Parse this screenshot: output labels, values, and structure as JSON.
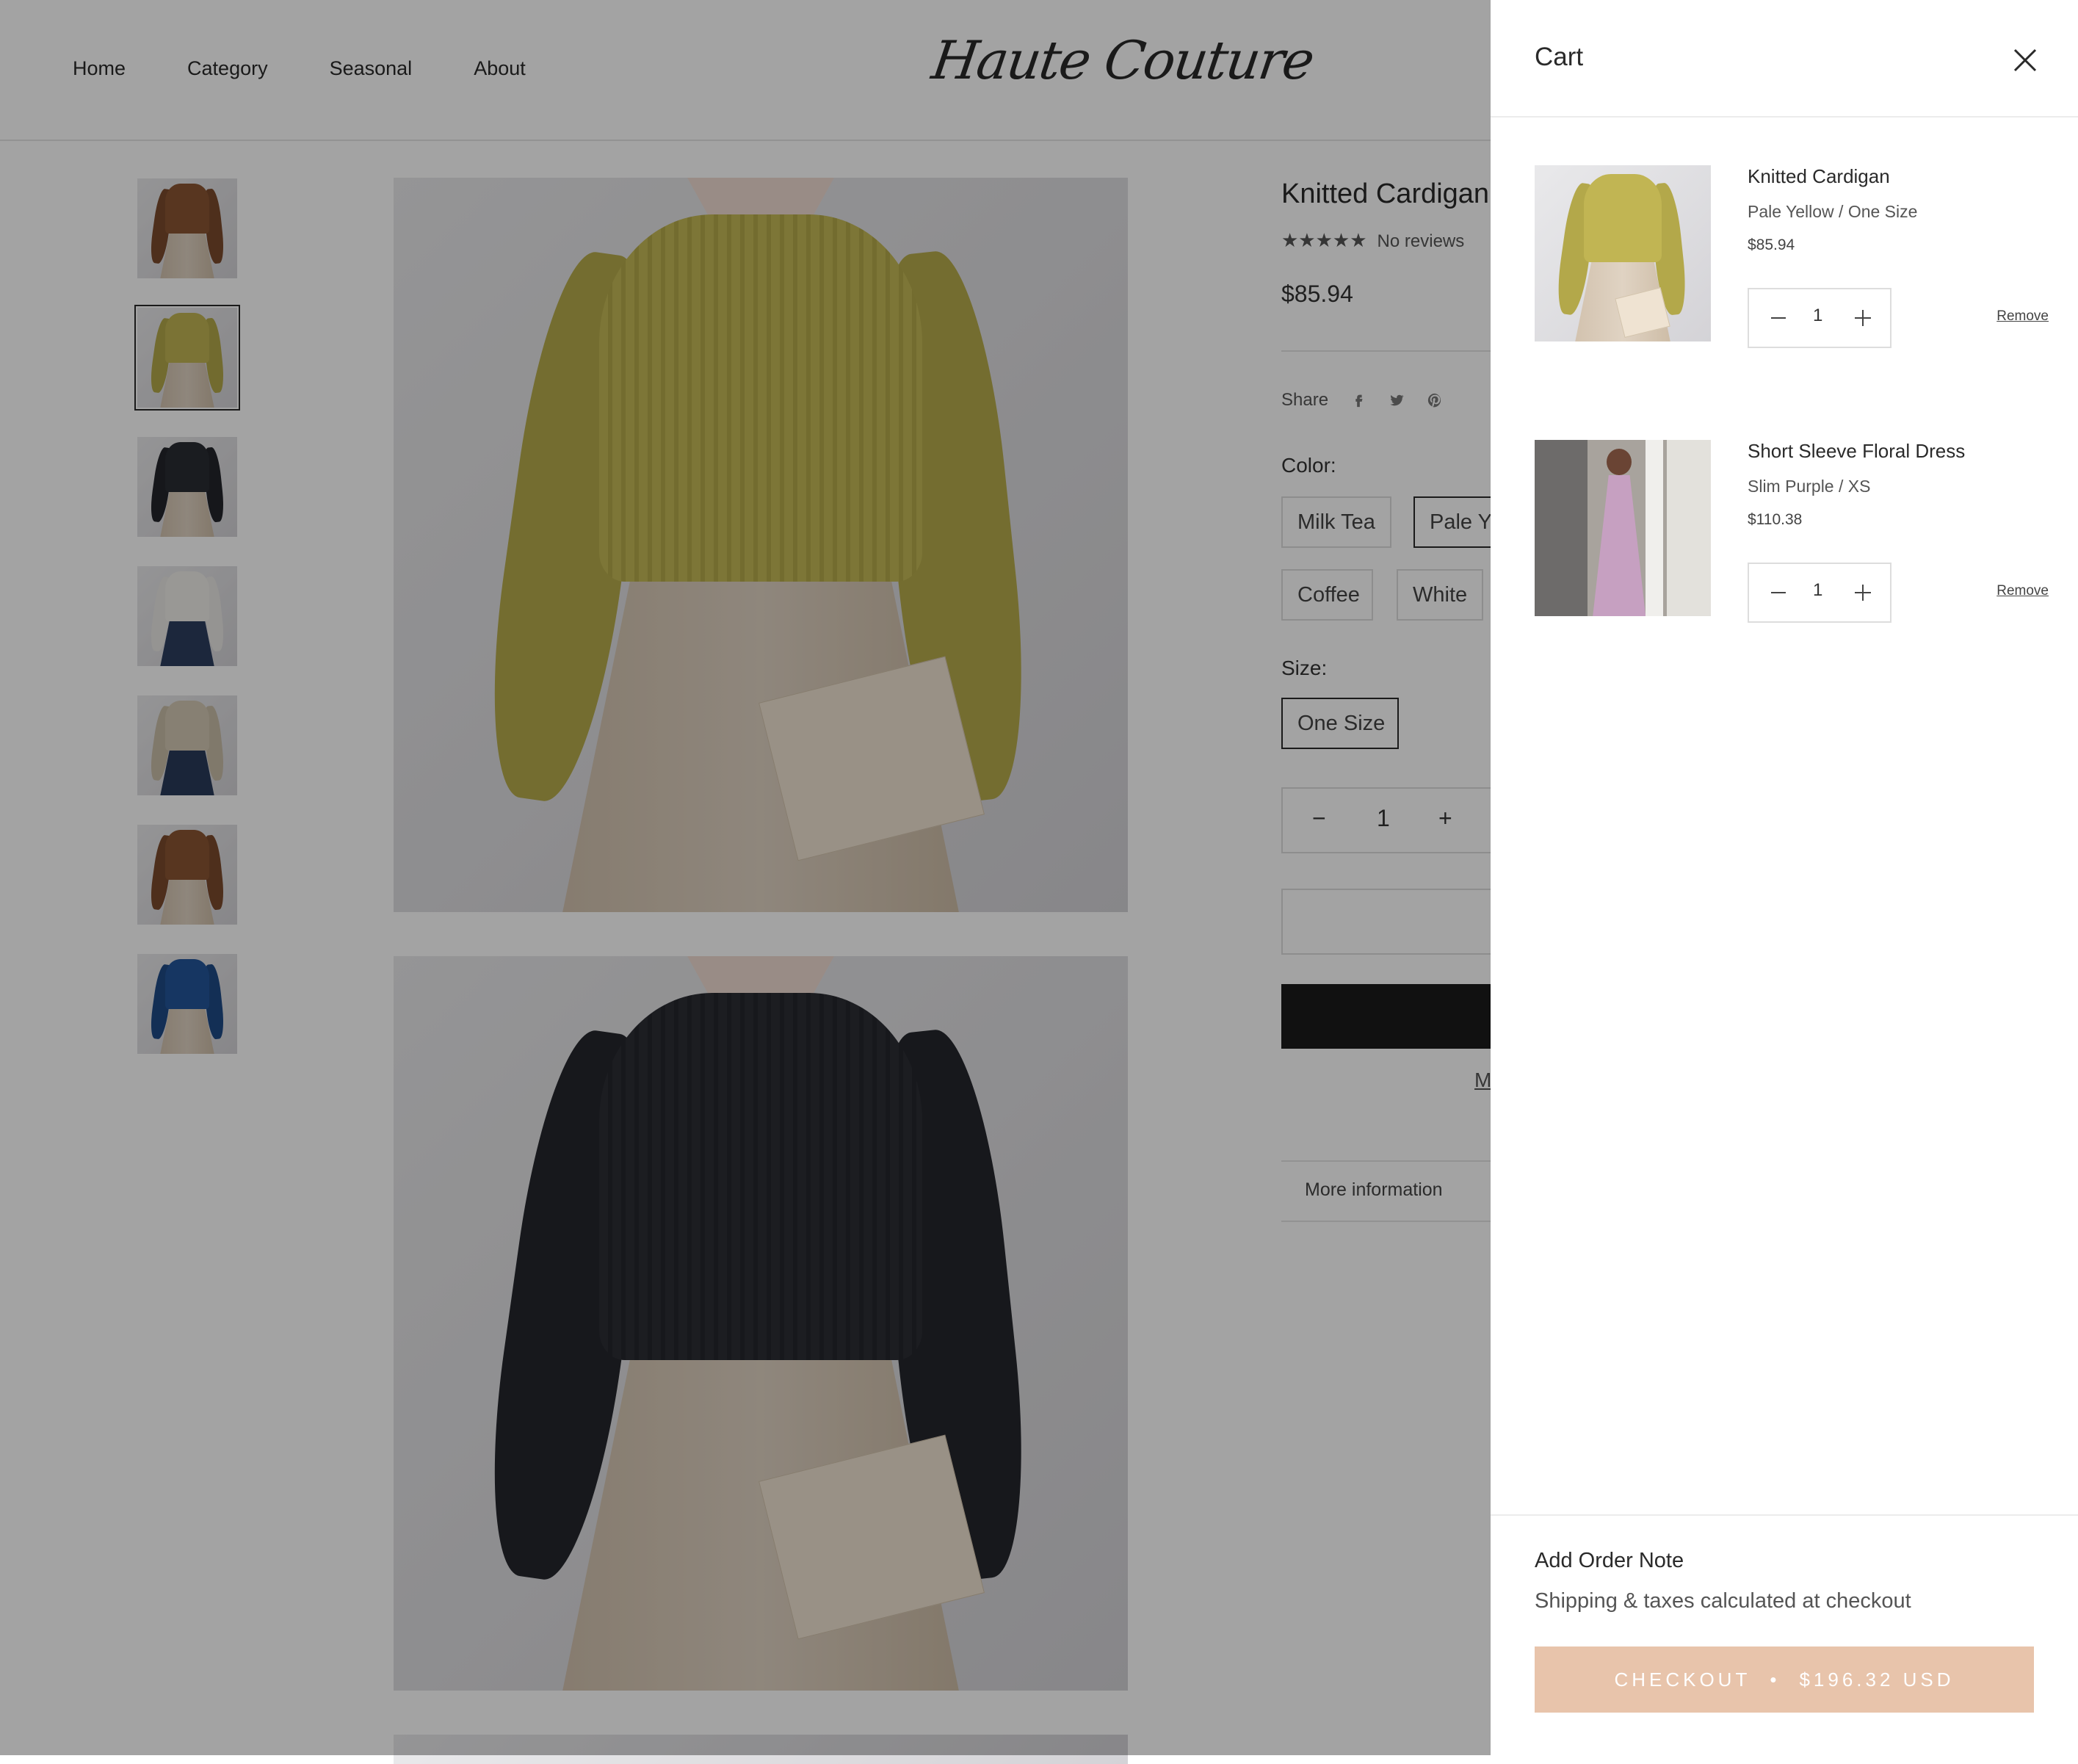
{
  "nav": {
    "items": [
      "Home",
      "Category",
      "Seasonal",
      "About"
    ]
  },
  "logo": {
    "text": "Haute Couture"
  },
  "product": {
    "title": "Knitted Cardigan",
    "stars": "★★★★★",
    "reviews": "No reviews",
    "price": "$85.94",
    "share_label": "Share",
    "color_label": "Color:",
    "colors": [
      "Milk Tea",
      "Pale Ye",
      "Coffee",
      "White"
    ],
    "size_label": "Size:",
    "size": "One Size",
    "qty": "1",
    "more_link": "M",
    "more_info": "More information"
  },
  "cart": {
    "title": "Cart",
    "items": [
      {
        "name": "Knitted Cardigan",
        "variant": "Pale Yellow / One Size",
        "price": "$85.94",
        "qty": "1",
        "remove": "Remove"
      },
      {
        "name": "Short Sleeve Floral Dress",
        "variant": "Slim Purple / XS",
        "price": "$110.38",
        "qty": "1",
        "remove": "Remove"
      }
    ],
    "note": "Add Order Note",
    "shipping": "Shipping & taxes calculated at checkout",
    "checkout_label": "CHECKOUT",
    "checkout_sep": "•",
    "checkout_total": "$196.32 USD"
  },
  "colors": {
    "checkout_bg": "#e8c4ab",
    "overlay": "rgba(0,0,0,0.36)",
    "buy_button": "#1c1c1c"
  },
  "icons": {
    "close": "close-icon",
    "facebook": "facebook-icon",
    "twitter": "twitter-icon",
    "pinterest": "pinterest-icon"
  }
}
